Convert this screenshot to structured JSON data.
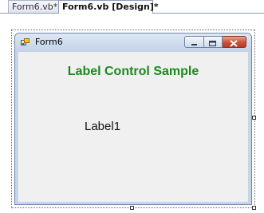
{
  "tabs": [
    {
      "label": "Form6.vb*",
      "active": false
    },
    {
      "label": "Form6.vb [Design]*",
      "active": true
    }
  ],
  "form": {
    "title": "Form6",
    "icon": "form-icon",
    "controls": {
      "minimize": "minimize-icon",
      "maximize": "maximize-icon",
      "close": "close-icon"
    }
  },
  "labels": {
    "heading": "Label Control Sample",
    "label1": "Label1"
  },
  "colors": {
    "heading": "#1b8a1b",
    "close_button": "#c7503a",
    "client": "#f0f0f0"
  }
}
